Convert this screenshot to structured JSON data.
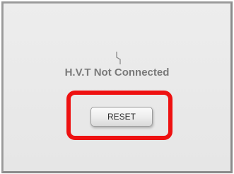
{
  "status": {
    "icon": "unplugged-bolt-icon",
    "message": "H.V.T Not Connected"
  },
  "actions": {
    "reset_label": "RESET"
  },
  "colors": {
    "panel_background": "#e9e9e9",
    "panel_border": "#9a9a9a",
    "highlight": "#ee1111",
    "status_text": "#7a7a7a"
  }
}
